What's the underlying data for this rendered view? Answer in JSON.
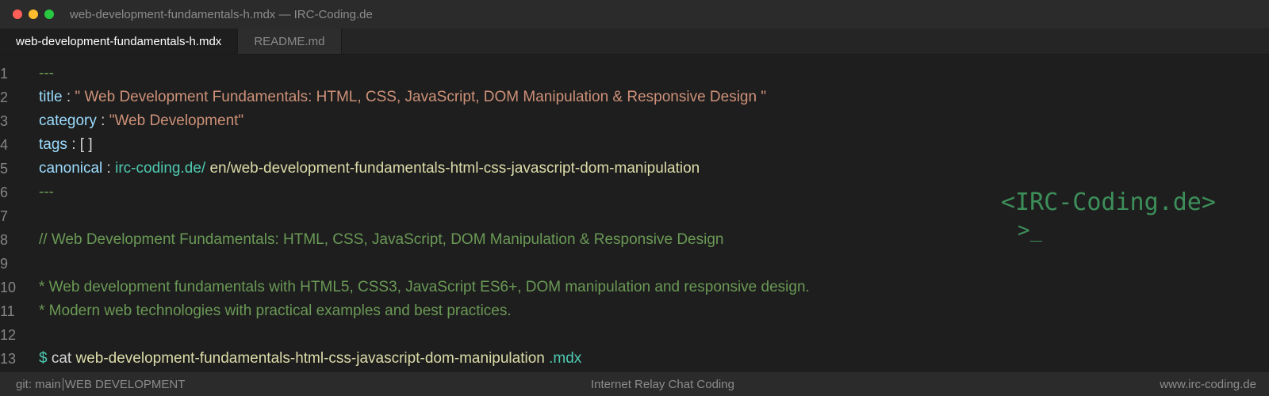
{
  "window": {
    "title": "web-development-fundamentals-h.mdx — IRC-Coding.de",
    "lights": {
      "close": "#ff5f57",
      "minimize": "#febc2e",
      "zoom": "#28c840"
    }
  },
  "tabs": [
    {
      "label": "web-development-fundamentals-h.mdx",
      "active": true
    },
    {
      "label": "README.md",
      "active": false
    }
  ],
  "editor": {
    "line_numbers": [
      "1",
      "2",
      "3",
      "4",
      "5",
      "6",
      "7",
      "8",
      "9",
      "10",
      "11",
      "12",
      "13"
    ],
    "line1": "---",
    "line2": {
      "key": "title",
      "colon": " : ",
      "value": "\" Web Development Fundamentals: HTML, CSS, JavaScript, DOM Manipulation & Responsive Design \""
    },
    "line3": {
      "key": "category",
      "colon": " : ",
      "value": "\"Web Development\""
    },
    "line4": {
      "key": "tags",
      "colon": " : ",
      "value": "[ ]"
    },
    "line5": {
      "key": "canonical",
      "colon": " : ",
      "domain": "irc-coding.de/",
      "path": " en/web-development-fundamentals-html-css-javascript-dom-manipulation"
    },
    "line6": "---",
    "line8": "// Web Development Fundamentals: HTML, CSS, JavaScript, DOM Manipulation & Responsive Design",
    "line10": "* Web development fundamentals with HTML5, CSS3, JavaScript ES6+, DOM manipulation and responsive design.",
    "line11": "* Modern web technologies with practical examples and best practices.",
    "line13": {
      "prompt": "$",
      "cmd": " cat ",
      "file": "web-development-fundamentals-html-css-javascript-dom-manipulation",
      "ext": " .mdx"
    }
  },
  "logo": {
    "text": "<IRC-Coding.de>",
    "cursor": ">_"
  },
  "statusbar": {
    "branch": "git: main",
    "category": "WEB DEVELOPMENT",
    "center": "Internet Relay Chat Coding",
    "right": "www.irc-coding.de"
  }
}
